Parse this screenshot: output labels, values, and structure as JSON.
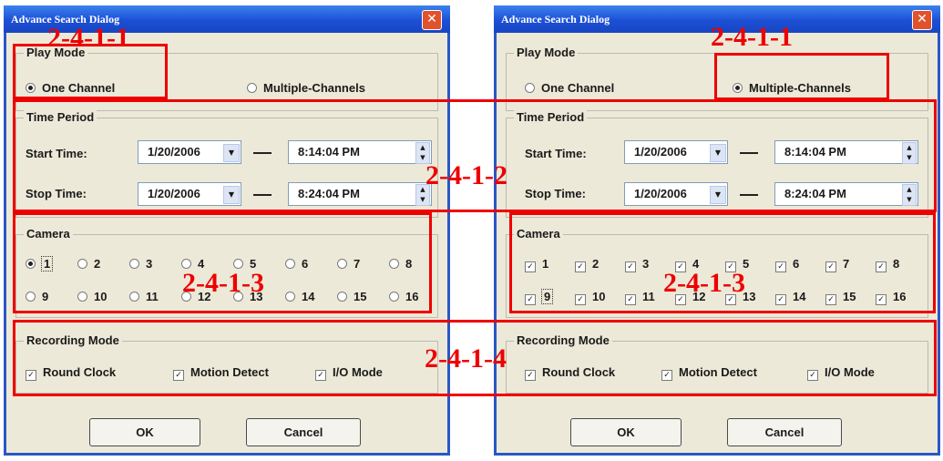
{
  "colors": {
    "annotation": "#ee0000",
    "titlebar": "#1c4fd6",
    "dialog_bg": "#ece9d8"
  },
  "icons": {
    "close": "close-icon",
    "dropdown": "chevron-down-icon",
    "spinner": "spinner-arrows-icon",
    "checkmark": "checkmark-icon"
  },
  "dialogs": [
    {
      "title": "Advance Search Dialog",
      "play_mode": {
        "label": "Play Mode",
        "one_channel": "One Channel",
        "multiple_channels": "Multiple-Channels",
        "selected": "one_channel"
      },
      "time_period": {
        "label": "Time Period",
        "start_label": "Start Time:",
        "start_date": "1/20/2006",
        "start_time": "8:14:04 PM",
        "stop_label": "Stop Time:",
        "stop_date": "1/20/2006",
        "stop_time": "8:24:04 PM"
      },
      "camera": {
        "label": "Camera",
        "control": "radio",
        "channels": [
          "1",
          "2",
          "3",
          "4",
          "5",
          "6",
          "7",
          "8",
          "9",
          "10",
          "11",
          "12",
          "13",
          "14",
          "15",
          "16"
        ],
        "selected": [
          "1"
        ],
        "focused": "1"
      },
      "recording_mode": {
        "label": "Recording Mode",
        "round_clock": "Round Clock",
        "motion_detect": "Motion Detect",
        "io_mode": "I/O Mode"
      },
      "ok_label": "OK",
      "cancel_label": "Cancel"
    },
    {
      "title": "Advance Search Dialog",
      "play_mode": {
        "label": "Play Mode",
        "one_channel": "One Channel",
        "multiple_channels": "Multiple-Channels",
        "selected": "multiple_channels"
      },
      "time_period": {
        "label": "Time Period",
        "start_label": "Start Time:",
        "start_date": "1/20/2006",
        "start_time": "8:14:04 PM",
        "stop_label": "Stop Time:",
        "stop_date": "1/20/2006",
        "stop_time": "8:24:04 PM"
      },
      "camera": {
        "label": "Camera",
        "control": "checkbox",
        "channels": [
          "1",
          "2",
          "3",
          "4",
          "5",
          "6",
          "7",
          "8",
          "9",
          "10",
          "11",
          "12",
          "13",
          "14",
          "15",
          "16"
        ],
        "selected": [
          "1",
          "2",
          "3",
          "4",
          "5",
          "6",
          "7",
          "8",
          "9",
          "10",
          "11",
          "12",
          "13",
          "14",
          "15",
          "16"
        ],
        "focused": "9"
      },
      "recording_mode": {
        "label": "Recording Mode",
        "round_clock": "Round Clock",
        "motion_detect": "Motion Detect",
        "io_mode": "I/O Mode"
      },
      "ok_label": "OK",
      "cancel_label": "Cancel"
    }
  ],
  "annotations": [
    "2-4-1-1",
    "2-4-1-1",
    "2-4-1-2",
    "2-4-1-3",
    "2-4-1-3",
    "2-4-1-4"
  ]
}
